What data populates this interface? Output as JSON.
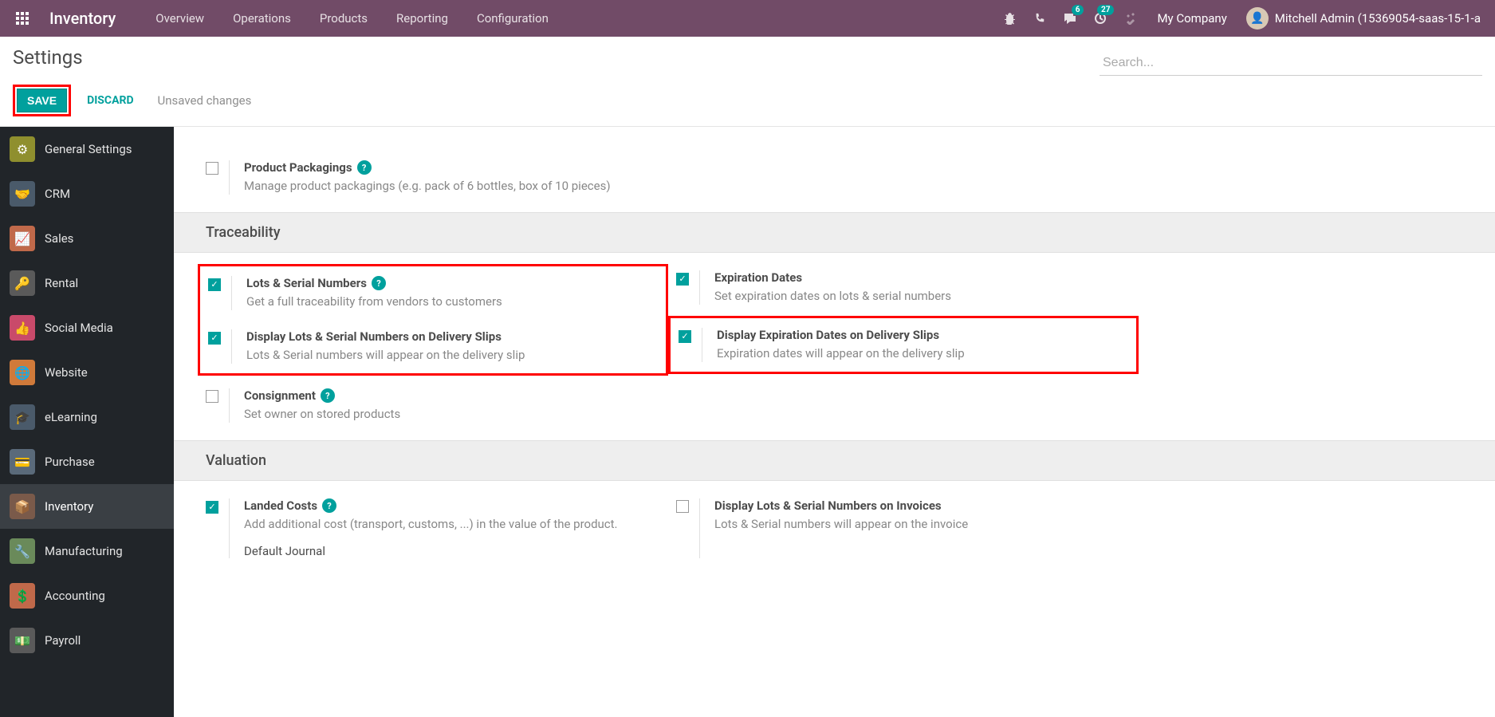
{
  "topbar": {
    "app_title": "Inventory",
    "menu": [
      "Overview",
      "Operations",
      "Products",
      "Reporting",
      "Configuration"
    ],
    "messages_badge": "6",
    "activities_badge": "27",
    "company": "My Company",
    "user": "Mitchell Admin (15369054-saas-15-1-a"
  },
  "control": {
    "title": "Settings",
    "save": "Save",
    "discard": "Discard",
    "unsaved": "Unsaved changes",
    "search_placeholder": "Search..."
  },
  "sidebar": {
    "items": [
      {
        "label": "General Settings",
        "color": "#8f8f2e"
      },
      {
        "label": "CRM",
        "color": "#4a5a6a"
      },
      {
        "label": "Sales",
        "color": "#c0694a"
      },
      {
        "label": "Rental",
        "color": "#5a5a5a"
      },
      {
        "label": "Social Media",
        "color": "#c94a6a"
      },
      {
        "label": "Website",
        "color": "#d07a3a"
      },
      {
        "label": "eLearning",
        "color": "#4a5a6a"
      },
      {
        "label": "Purchase",
        "color": "#5a6a7a"
      },
      {
        "label": "Inventory",
        "color": "#7a5a4a",
        "active": true
      },
      {
        "label": "Manufacturing",
        "color": "#6a8a5a"
      },
      {
        "label": "Accounting",
        "color": "#c0694a"
      },
      {
        "label": "Payroll",
        "color": "#5a5a5a"
      }
    ]
  },
  "settings": {
    "packaging": {
      "title": "Product Packagings",
      "desc": "Manage product packagings (e.g. pack of 6 bottles, box of 10 pieces)"
    },
    "section_traceability": "Traceability",
    "lots": {
      "title": "Lots & Serial Numbers",
      "desc": "Get a full traceability from vendors to customers"
    },
    "expiration": {
      "title": "Expiration Dates",
      "desc": "Set expiration dates on lots & serial numbers"
    },
    "display_lots_slip": {
      "title": "Display Lots & Serial Numbers on Delivery Slips",
      "desc": "Lots & Serial numbers will appear on the delivery slip"
    },
    "display_exp_slip": {
      "title": "Display Expiration Dates on Delivery Slips",
      "desc": "Expiration dates will appear on the delivery slip"
    },
    "consignment": {
      "title": "Consignment",
      "desc": "Set owner on stored products"
    },
    "section_valuation": "Valuation",
    "landed": {
      "title": "Landed Costs",
      "desc": "Add additional cost (transport, customs, ...) in the value of the product."
    },
    "display_lots_invoice": {
      "title": "Display Lots & Serial Numbers on Invoices",
      "desc": "Lots & Serial numbers will appear on the invoice"
    },
    "default_journal": "Default Journal"
  }
}
